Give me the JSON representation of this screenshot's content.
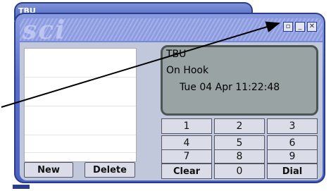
{
  "window": {
    "title": "TBU",
    "logo": "sci"
  },
  "title_buttons": [
    {
      "name": "restore",
      "glyph": "▫"
    },
    {
      "name": "minimize",
      "glyph": "_"
    },
    {
      "name": "close",
      "glyph": "✕"
    }
  ],
  "left_panel": {
    "new_label": "New",
    "delete_label": "Delete"
  },
  "display": {
    "line1": "TBU",
    "line2": "On Hook",
    "line3": "Tue 04 Apr 11:22:48"
  },
  "keypad": {
    "k1": "1",
    "k2": "2",
    "k3": "3",
    "k4": "4",
    "k5": "5",
    "k6": "6",
    "k7": "7",
    "k8": "8",
    "k9": "9",
    "clear": "Clear",
    "k0": "0",
    "dial": "Dial"
  }
}
